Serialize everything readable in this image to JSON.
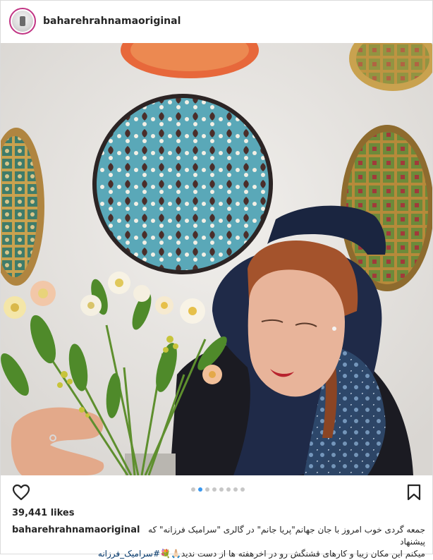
{
  "post": {
    "username": "baharehrahnamaoriginal",
    "likes": "39,441 likes",
    "carousel": {
      "count": 8,
      "active_index": 1
    },
    "caption": {
      "username": "baharehrahnamaoriginal",
      "line1": "جمعه گردی خوب امروز با جان جهانم\"پریا جانم\" در گالری \"سرامیک فرزانه\" که پیشنهاد",
      "line2_text": "میکنم این مکان زیبا و کارهای قشنگش رو در اخرهفته ها از دست ندید",
      "line2_emoji": "🙏🏻💐",
      "hashtag": "#سرامیک_فرزانه"
    }
  },
  "icons": {
    "like": "heart-outline-icon",
    "save": "bookmark-outline-icon"
  },
  "colors": {
    "active_dot": "#3897f0",
    "inactive_dot": "#c7c7c7",
    "hashtag": "#003569"
  }
}
